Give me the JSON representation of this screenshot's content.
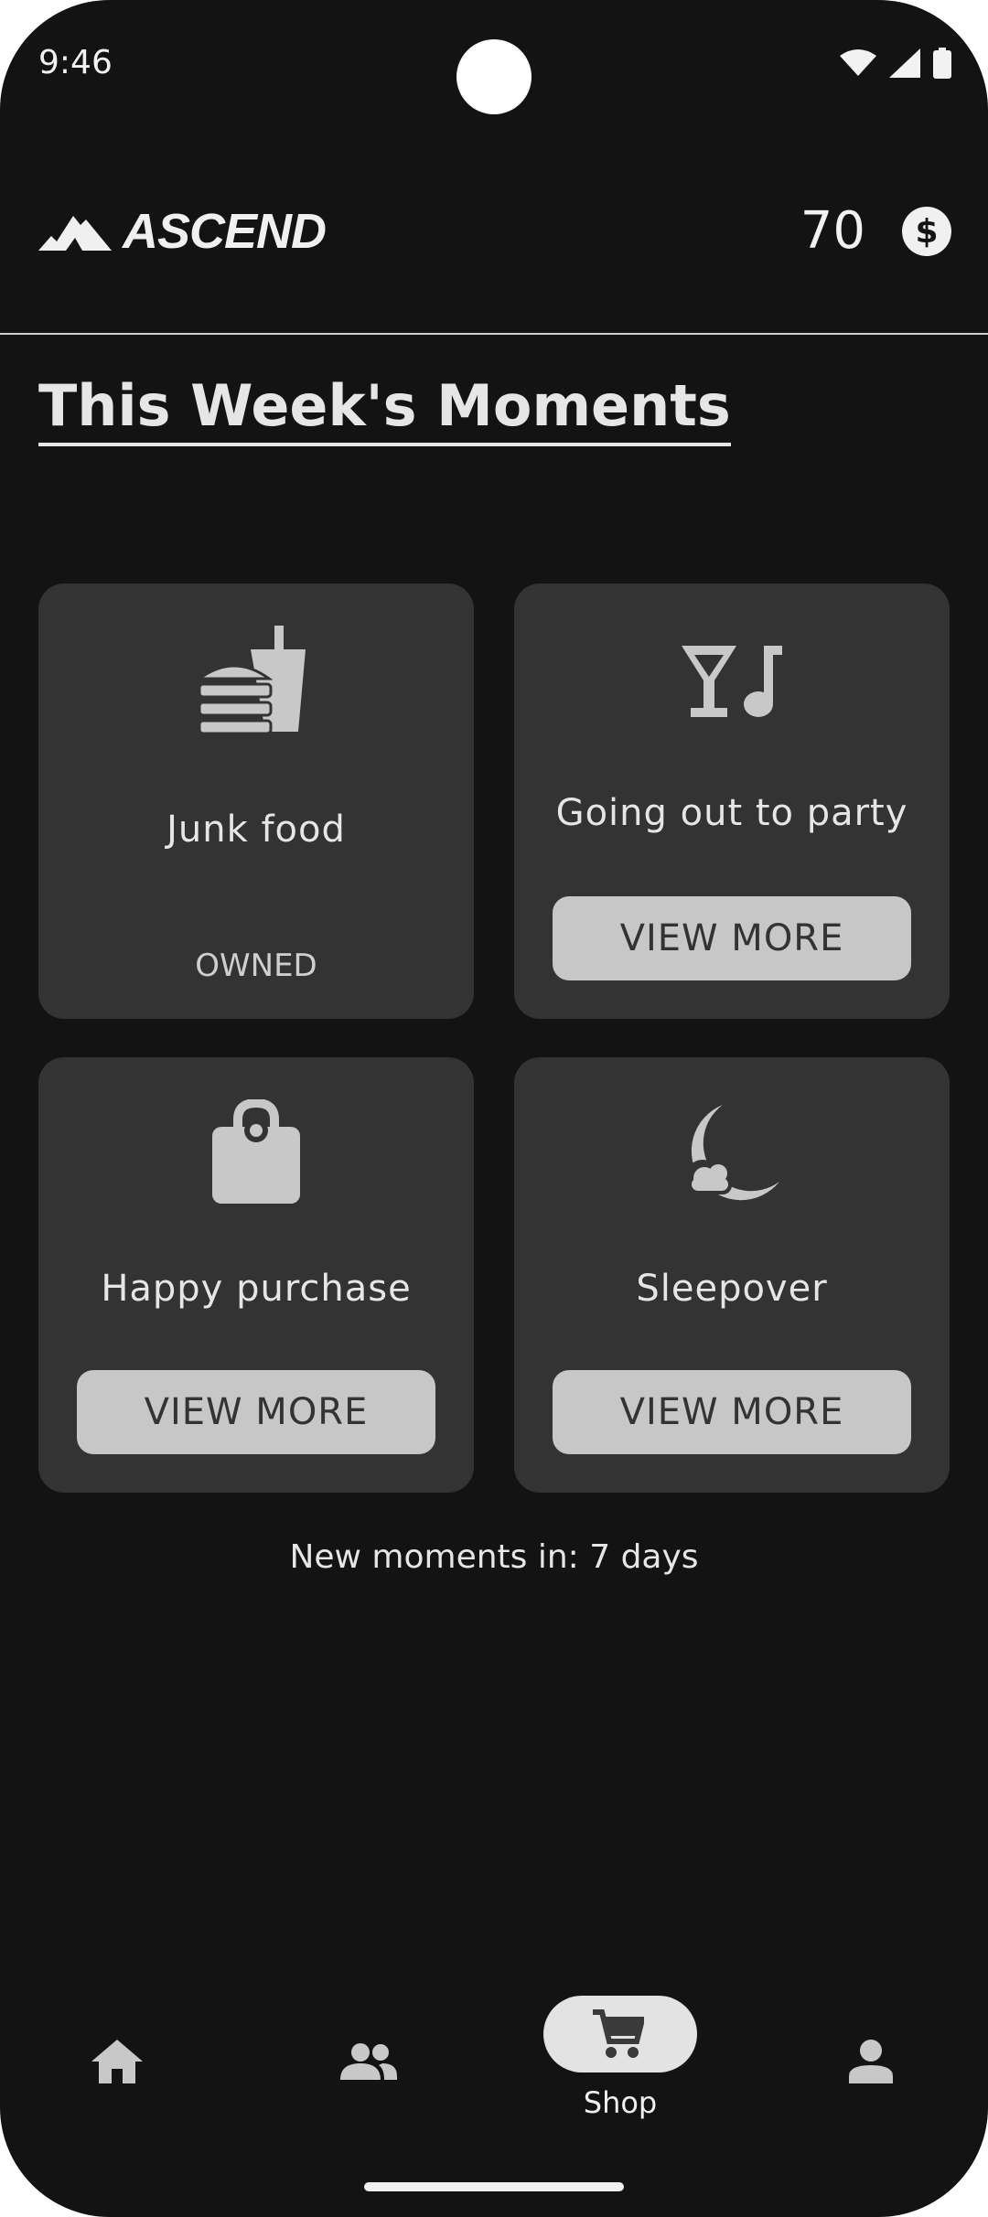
{
  "status": {
    "time": "9:46"
  },
  "header": {
    "logo_text": "ASCEND",
    "coins": "70"
  },
  "page_title": "This Week's Moments",
  "cards": [
    {
      "label": "Junk food",
      "status": "OWNED",
      "icon": "fastfood-icon"
    },
    {
      "label": "Going out to party",
      "button": "VIEW MORE",
      "icon": "nightlife-icon"
    },
    {
      "label": "Happy purchase",
      "button": "VIEW MORE",
      "icon": "shopping-bag-icon"
    },
    {
      "label": "Sleepover",
      "button": "VIEW MORE",
      "icon": "night-cloud-icon"
    }
  ],
  "footer_note": "New moments in: 7 days",
  "nav": {
    "items": [
      {
        "icon": "home-icon"
      },
      {
        "icon": "people-icon"
      },
      {
        "icon": "cart-icon",
        "label": "Shop",
        "active": true
      },
      {
        "icon": "person-icon"
      }
    ]
  },
  "colors": {
    "background": "#131313",
    "card": "#333333",
    "button": "#c7c7c7",
    "text": "#e6e6e6"
  }
}
